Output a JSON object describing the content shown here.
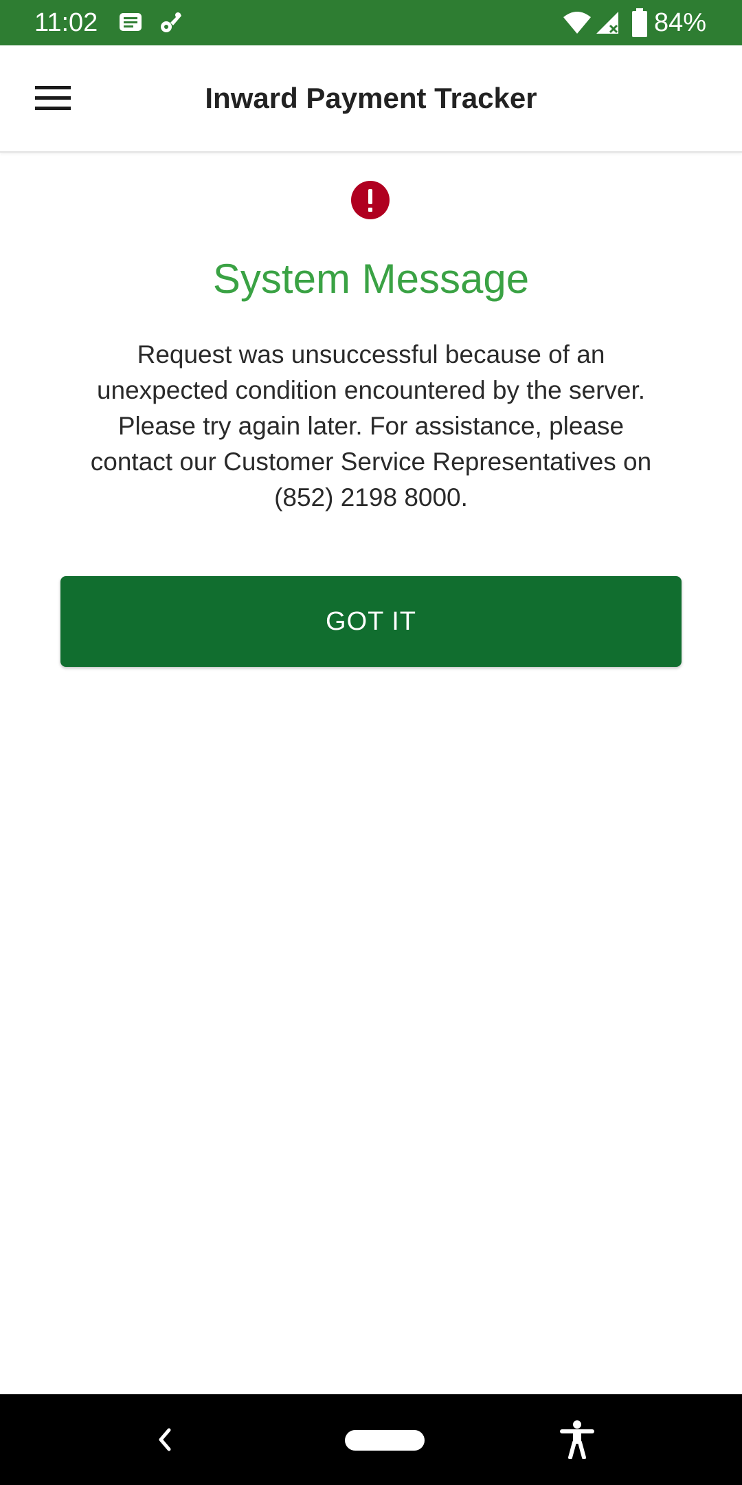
{
  "status_bar": {
    "time": "11:02",
    "battery_text": "84%",
    "icons": [
      "message-icon",
      "assistant-icon",
      "wifi-icon",
      "signal-icon",
      "battery-icon"
    ]
  },
  "app_bar": {
    "title": "Inward Payment Tracker",
    "menu_icon": "hamburger-menu-icon"
  },
  "dialog": {
    "icon": "error-icon",
    "title": "System Message",
    "body": "Request was unsuccessful because of an unexpected condition encountered by the server. Please try again later. For assistance, please contact our Customer Service Representatives on (852) 2198 8000.",
    "button_label": "GOT IT"
  },
  "nav_bar": {
    "icons": [
      "back-icon",
      "home-pill",
      "accessibility-icon"
    ]
  },
  "colors": {
    "status_bar": "#2e7d32",
    "title_green": "#3aa244",
    "button_green": "#116e2f",
    "error_red": "#b00020"
  }
}
